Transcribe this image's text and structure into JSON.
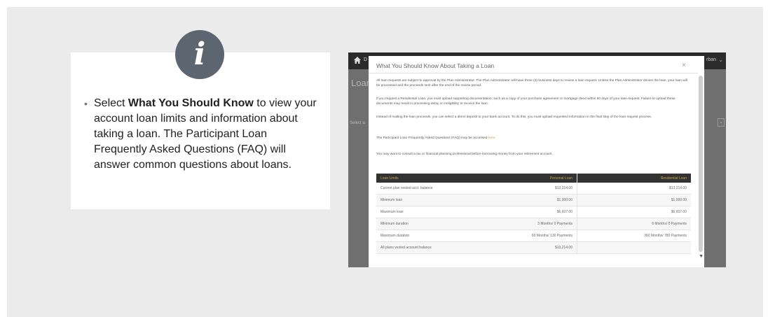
{
  "instructions": {
    "bullet": "•",
    "prefix": "Select ",
    "bold": "What You Should Know",
    "suffix": " to view your account loan limits and information about taking a loan. The Participant Loan Frequently Asked Questions (FAQ) will answer common questions about loans."
  },
  "info_icon": "i",
  "background_app": {
    "nav_initial": "D",
    "user_fragment": "rban",
    "page_title_fragment": "Loan",
    "select_fragment": "Select a"
  },
  "modal": {
    "title": "What You Should Know About Taking a Loan",
    "close_glyph": "×",
    "paragraphs": [
      "All loan requests are subject to approval by the Plan Administrator. The Plan Administrator will have three (3) business days to review a loan request. Unless the Plan Administrator denies the loan, your loan will be processed and the proceeds sent after the end of the review period.",
      "If you request a Residential Loan, you must upload supporting documentation, such as a copy of your purchase agreement or mortgage deed within 90 days of your loan request. Failure to upload these documents may result in processing delay or ineligibility to receive the loan.",
      "Instead of mailing the loan proceeds, you can select a direct deposit to your bank account. To do this, you must upload requested information in the final step of the loan request process."
    ],
    "faq_text": "The Participant Loan Frequently Asked Questions (FAQ) may be accessed ",
    "faq_link": "here",
    "faq_end": ".",
    "consult_text": "You may want to consult a tax or financial planning professional before borrowing money from your retirement account.",
    "table": {
      "headers": [
        "Loan Limits",
        "Personal Loan",
        "Residential Loan"
      ],
      "rows": [
        [
          "Current plan vested acct. balance",
          "$13,214.00",
          "$13,214.00"
        ],
        [
          "Minimum loan",
          "$1,000.00",
          "$1,000.00"
        ],
        [
          "Maximum loan",
          "$6,607.00",
          "$6,607.00"
        ],
        [
          "Minimum duration",
          "3 Months/ 0 Payments",
          "6 Months/ 0 Payments"
        ],
        [
          "Maximum duration",
          "60 Months/ 130 Payments",
          "360 Months/ 780 Payments"
        ],
        [
          "All plans vested account balance",
          "$13,214.00",
          ""
        ]
      ]
    }
  },
  "colors": {
    "panel_bg": "#ebebeb",
    "icon_circle": "#5b6670",
    "table_header_bg": "#333333",
    "table_header_text": "#c8a24a",
    "link": "#c8a24a"
  }
}
